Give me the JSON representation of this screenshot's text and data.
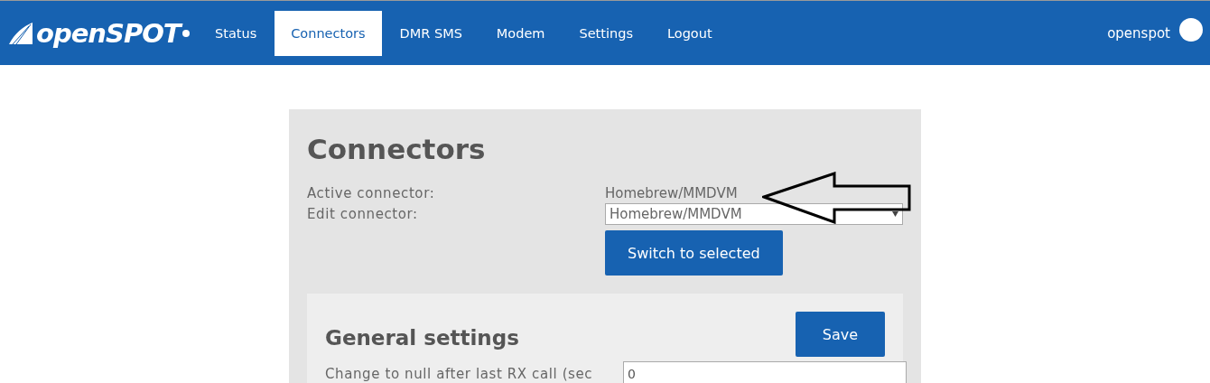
{
  "brand": {
    "name": "openSPOT"
  },
  "nav": [
    {
      "label": "Status",
      "selected": false
    },
    {
      "label": "Connectors",
      "selected": true
    },
    {
      "label": "DMR SMS",
      "selected": false
    },
    {
      "label": "Modem",
      "selected": false
    },
    {
      "label": "Settings",
      "selected": false
    },
    {
      "label": "Logout",
      "selected": false
    }
  ],
  "user": {
    "name": "openspot"
  },
  "page": {
    "title": "Connectors",
    "active_label": "Active connector:",
    "active_value": "Homebrew/MMDVM",
    "edit_label": "Edit connector:",
    "edit_value": "Homebrew/MMDVM",
    "switch_button": "Switch to selected"
  },
  "general": {
    "title": "General settings",
    "save_button": "Save",
    "field_label": "Change to null after last RX call (sec",
    "field_value": "0"
  }
}
